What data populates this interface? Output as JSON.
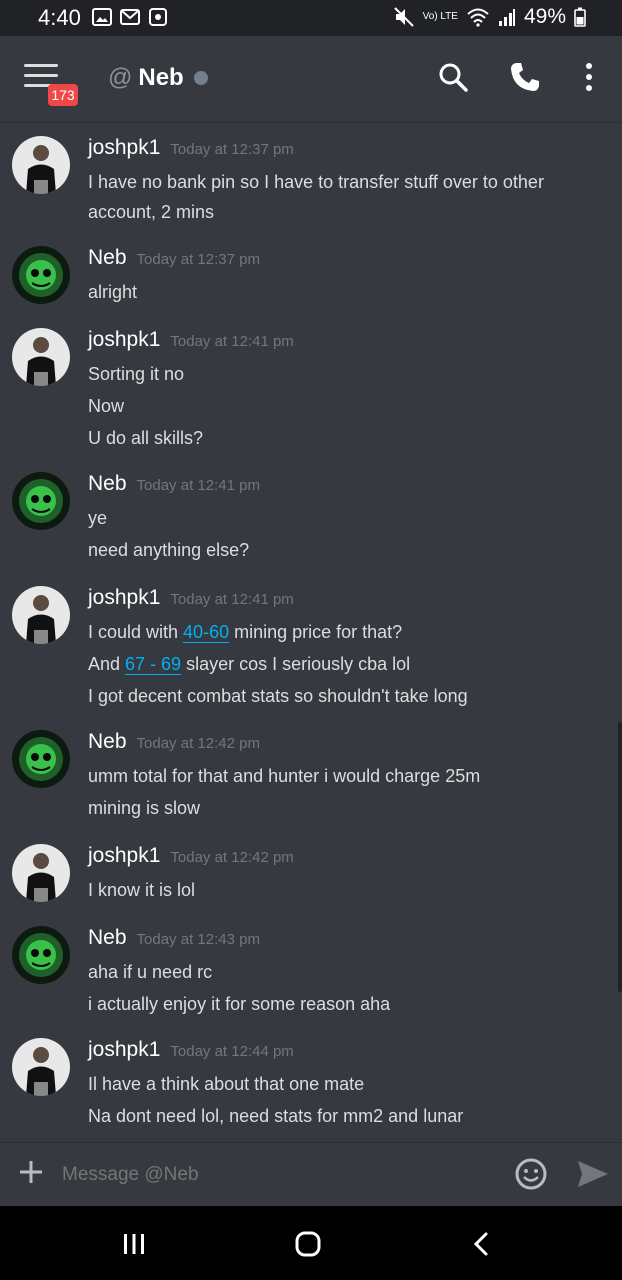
{
  "status_bar": {
    "time": "4:40",
    "network": "Vo) LTE",
    "battery": "49%"
  },
  "header": {
    "at": "@",
    "channel_name": "Neb",
    "unread_badge": "173"
  },
  "messages": [
    {
      "author": "joshpk1",
      "timestamp": "Today at 12:37 pm",
      "lines": [
        "I have no bank pin so I have to transfer stuff over to other",
        "account, 2 mins"
      ]
    },
    {
      "author": "Neb",
      "timestamp": "Today at 12:37 pm",
      "lines": [
        "alright"
      ]
    },
    {
      "author": "joshpk1",
      "timestamp": "Today at 12:41 pm",
      "lines": [
        "Sorting it no",
        "Now",
        "U do all skills?"
      ]
    },
    {
      "author": "Neb",
      "timestamp": "Today at 12:41 pm",
      "lines": [
        "ye",
        "need anything else?"
      ]
    },
    {
      "author": "joshpk1",
      "timestamp": "Today at 12:41 pm",
      "line1_pre": "I could with ",
      "line1_link": "40-60",
      "line1_post": " mining price for that?",
      "line2_pre": "And ",
      "line2_link": "67 - 69",
      "line2_post": " slayer cos I seriously cba lol",
      "line3": "I got decent combat stats so shouldn't take long"
    },
    {
      "author": "Neb",
      "timestamp": "Today at 12:42 pm",
      "lines": [
        "umm total for that and hunter i would charge 25m",
        "mining is slow"
      ]
    },
    {
      "author": "joshpk1",
      "timestamp": "Today at 12:42 pm",
      "lines": [
        "I know it is lol"
      ]
    },
    {
      "author": "Neb",
      "timestamp": "Today at 12:43 pm",
      "lines": [
        "aha if u need rc",
        "i actually enjoy it for some reason aha"
      ]
    },
    {
      "author": "joshpk1",
      "timestamp": "Today at 12:44 pm",
      "lines": [
        "Il have a think about that one mate",
        "Na dont need lol, need stats for mm2 and lunar"
      ]
    }
  ],
  "input": {
    "placeholder": "Message @Neb"
  },
  "icons": {
    "menu": "hamburger-icon",
    "search": "search-icon",
    "call": "phone-icon",
    "more": "more-vertical-icon",
    "add": "plus-icon",
    "emoji": "emoji-icon",
    "send": "send-icon"
  },
  "colors": {
    "background": "#36393f",
    "link": "#00b0f4",
    "badge": "#f04747",
    "timestamp": "#72767d"
  }
}
